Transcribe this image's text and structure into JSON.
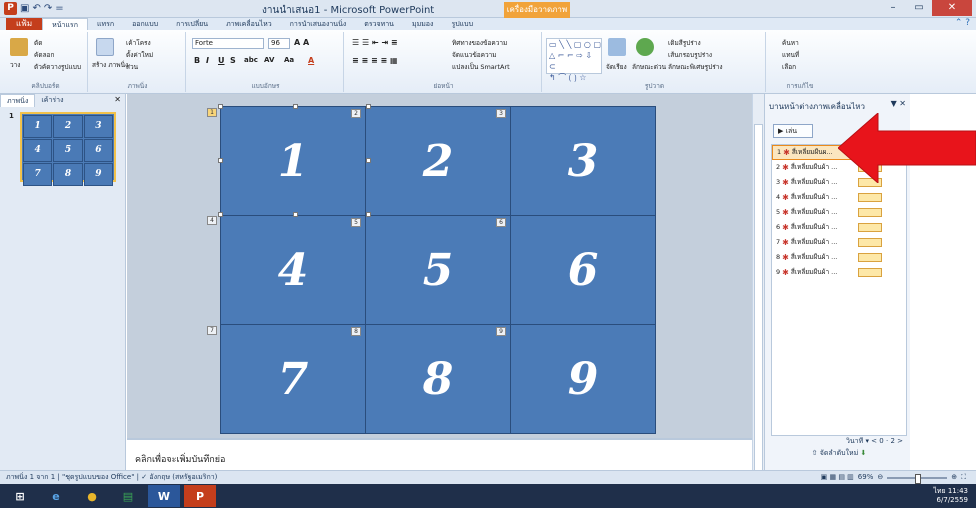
{
  "window": {
    "title": "งานนำเสนอ1 - Microsoft PowerPoint",
    "context_tab": "เครื่องมือวาดภาพ"
  },
  "qat": {
    "undo": "↶",
    "redo": "↷",
    "menu": "="
  },
  "tabs": {
    "file": "แฟ้ม",
    "items": [
      "หน้าแรก",
      "แทรก",
      "ออกแบบ",
      "การเปลี่ยน",
      "ภาพเคลื่อนไหว",
      "การนำเสนองานนิ่ง",
      "ตรวจทาน",
      "มุมมอง",
      "รูปแบบ"
    ]
  },
  "ribbon": {
    "clipboard": {
      "paste": "วาง",
      "cut": "ตัด",
      "copy": "คัดลอก",
      "format_painter": "ตัวคัดวางรูปแบบ",
      "label": "คลิปบอร์ด"
    },
    "slides": {
      "layout": "เค้าโครง",
      "reset": "ตั้งค่าใหม่",
      "section": "ส่วน",
      "new": "สร้าง ภาพนิ่ง",
      "label": "ภาพนิ่ง"
    },
    "font": {
      "name": "Forte",
      "size": "96",
      "label": "แบบอักษร"
    },
    "paragraph": {
      "label": "ย่อหน้า",
      "text_direction": "ทิศทางของข้อความ",
      "align_text": "จัดแนวข้อความ",
      "smartart": "แปลงเป็น SmartArt"
    },
    "drawing": {
      "label": "รูปวาด",
      "arrange": "จัดเรียง",
      "quick_styles": "ลักษณะด่วน",
      "fill": "เติมสีรูปร่าง",
      "outline": "เส้นกรอบรูปร่าง",
      "effects": "ลักษณะพิเศษรูปร่าง"
    },
    "editing": {
      "label": "การแก้ไข",
      "find": "ค้นหา",
      "replace": "แทนที่",
      "select": "เลือก"
    }
  },
  "left_panel": {
    "tabs": [
      "ภาพนิ่ง",
      "เค้าร่าง"
    ],
    "slide_number": "1",
    "thumb_numbers": [
      "1",
      "2",
      "3",
      "4",
      "5",
      "6",
      "7",
      "8",
      "9"
    ]
  },
  "slide": {
    "cells": [
      {
        "num": "1",
        "tag": "2"
      },
      {
        "num": "2",
        "tag": "3"
      },
      {
        "num": "3",
        "tag": ""
      },
      {
        "num": "4",
        "tag": "5"
      },
      {
        "num": "5",
        "tag": "6"
      },
      {
        "num": "6",
        "tag": ""
      },
      {
        "num": "7",
        "tag": "8"
      },
      {
        "num": "8",
        "tag": "9"
      },
      {
        "num": "9",
        "tag": ""
      }
    ],
    "side_tags": [
      "1",
      "4",
      "7"
    ]
  },
  "notes": {
    "placeholder": "คลิกเพื่อจะเพิ่มบันทึกย่อ"
  },
  "anim_pane": {
    "title": "บานหน้าต่างภาพเคลื่อนไหว",
    "play": "เล่น",
    "items": [
      {
        "n": "1",
        "label": "สี่เหลี่ยมผืนผ..."
      },
      {
        "n": "2",
        "label": "สี่เหลี่ยมผืนผ้า ..."
      },
      {
        "n": "3",
        "label": "สี่เหลี่ยมผืนผ้า ..."
      },
      {
        "n": "4",
        "label": "สี่เหลี่ยมผืนผ้า ..."
      },
      {
        "n": "5",
        "label": "สี่เหลี่ยมผืนผ้า ..."
      },
      {
        "n": "6",
        "label": "สี่เหลี่ยมผืนผ้า ..."
      },
      {
        "n": "7",
        "label": "สี่เหลี่ยมผืนผ้า ..."
      },
      {
        "n": "8",
        "label": "สี่เหลี่ยมผืนผ้า ..."
      },
      {
        "n": "9",
        "label": "สี่เหลี่ยมผืนผ้า ..."
      }
    ],
    "timeline": "วินาที",
    "timeline_vals": [
      "0",
      "2"
    ],
    "reorder": "จัดลำดับใหม่"
  },
  "status": {
    "slide_info": "ภาพนิ่ง 1 จาก 1",
    "theme": "\"ชุดรูปแบบของ Office\"",
    "language": "อังกฤษ (สหรัฐอเมริกา)",
    "zoom": "69%"
  },
  "taskbar": {
    "time": "11:43",
    "date": "6/7/2559",
    "lang": "ไทย"
  },
  "colors": {
    "accent": "#c43e1c",
    "cell": "#4b7bb7",
    "arrow": "#e8141b"
  }
}
